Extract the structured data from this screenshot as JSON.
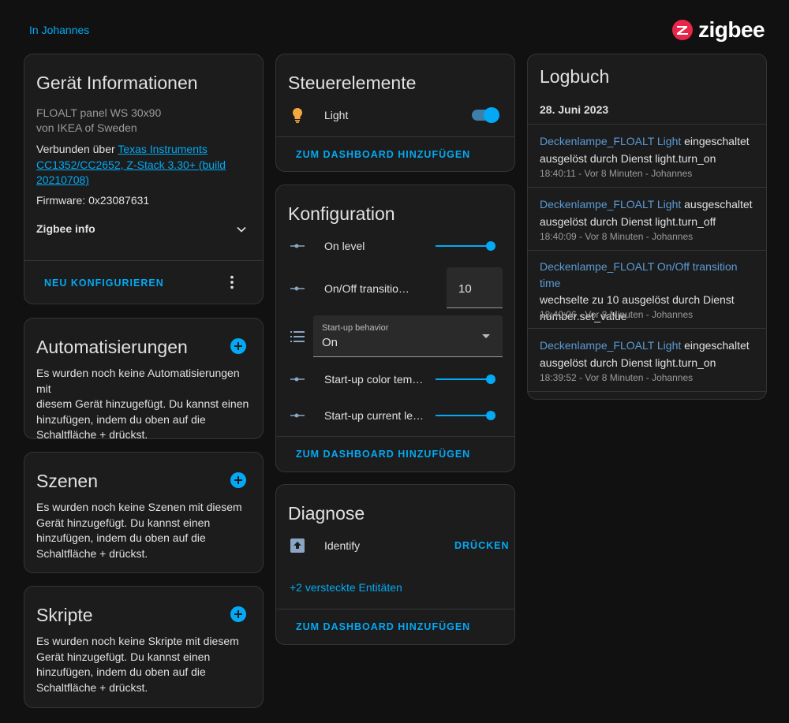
{
  "header": {
    "area_link": "In Johannes",
    "brand": "zigbee"
  },
  "colors": {
    "accent": "#03a9f4",
    "card_bg": "#1c1c1c",
    "page_bg": "#111111",
    "brand_red": "#e8264a"
  },
  "device_info": {
    "title": "Gerät Informationen",
    "model": "FLOALT panel WS 30x90",
    "manufacturer": "von IKEA of Sweden",
    "connected_prefix": "Verbunden über ",
    "connected_link_1": "Texas Instruments",
    "connected_link_2": "CC1352/CC2652, Z-Stack 3.30+ (build",
    "connected_link_3": "20210708)",
    "firmware": "Firmware: 0x23087631",
    "zigbee_info": "Zigbee info",
    "reconfigure": "NEU KONFIGURIEREN"
  },
  "automations": {
    "title": "Automatisierungen",
    "text_lines": [
      "Es wurden noch keine Automatisierungen mit",
      "diesem Gerät hinzugefügt. Du kannst einen",
      "hinzufügen, indem du oben auf die",
      "Schaltfläche + drückst."
    ]
  },
  "scenes": {
    "title": "Szenen",
    "text_lines": [
      "Es wurden noch keine Szenen mit diesem",
      "Gerät hinzugefügt. Du kannst einen",
      "hinzufügen, indem du oben auf die",
      "Schaltfläche + drückst."
    ]
  },
  "scripts": {
    "title": "Skripte",
    "text_lines": [
      "Es wurden noch keine Skripte mit diesem",
      "Gerät hinzugefügt. Du kannst einen",
      "hinzufügen, indem du oben auf die",
      "Schaltfläche + drückst."
    ]
  },
  "controls": {
    "title": "Steuerelemente",
    "light_label": "Light",
    "light_on": true,
    "add_dashboard": "ZUM DASHBOARD HINZUFÜGEN"
  },
  "configuration": {
    "title": "Konfiguration",
    "on_level": "On level",
    "on_level_value": 1.0,
    "transition_label": "On/Off transitio…",
    "transition_value": "10",
    "startup_behavior_label": "Start-up behavior",
    "startup_behavior_value": "On",
    "color_temp_label": "Start-up color tem…",
    "color_temp_value": 1.0,
    "current_level_label": "Start-up current le…",
    "current_level_value": 1.0,
    "add_dashboard": "ZUM DASHBOARD HINZUFÜGEN"
  },
  "diagnostics": {
    "title": "Diagnose",
    "identify_label": "Identify",
    "identify_button": "DRÜCKEN",
    "hidden_entities": "+2 versteckte Entitäten",
    "add_dashboard": "ZUM DASHBOARD HINZUFÜGEN"
  },
  "logbook": {
    "title": "Logbuch",
    "date": "28. Juni 2023",
    "entries": [
      {
        "name": "Deckenlampe_FLOALT Light",
        "action_line1": " eingeschaltet",
        "action_line2": "ausgelöst durch Dienst light.turn_on",
        "action_line3": "",
        "time": "18:40:11 - Vor 8 Minuten - Johannes"
      },
      {
        "name": "Deckenlampe_FLOALT Light",
        "action_line1": " ausgeschaltet",
        "action_line2": "ausgelöst durch Dienst light.turn_off",
        "action_line3": "",
        "time": "18:40:09 - Vor 8 Minuten - Johannes"
      },
      {
        "name": "Deckenlampe_FLOALT On/Off transition time",
        "action_line1": "",
        "action_line2": "wechselte zu 10 ausgelöst durch Dienst",
        "action_line3": "number.set_value",
        "time": "18:40:06 - Vor 8 Minuten - Johannes"
      },
      {
        "name": "Deckenlampe_FLOALT Light",
        "action_line1": " eingeschaltet",
        "action_line2": "ausgelöst durch Dienst light.turn_on",
        "action_line3": "",
        "time": "18:39:52 - Vor 8 Minuten - Johannes"
      }
    ]
  }
}
